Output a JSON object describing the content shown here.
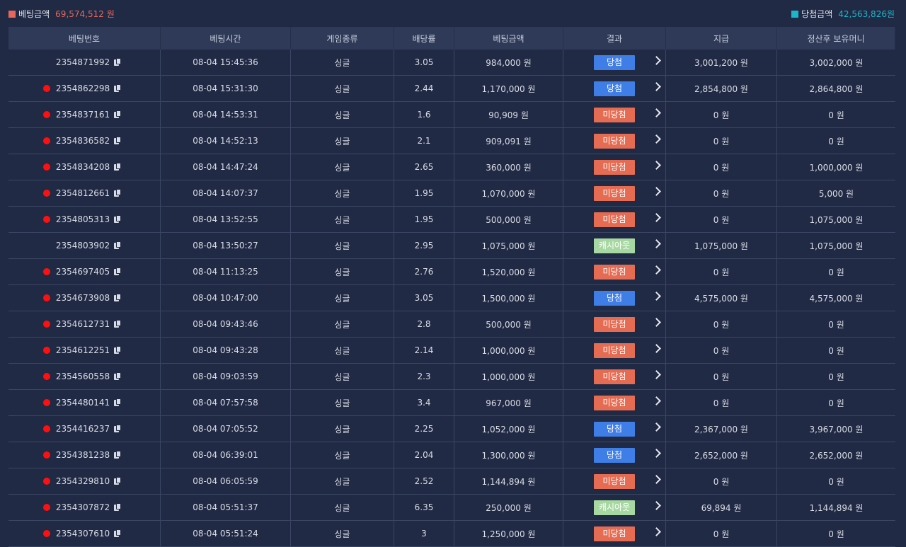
{
  "summary": {
    "bet_label": "베팅금액",
    "bet_value": "69,574,512 원",
    "win_label": "당첨금액",
    "win_value": "42,563,826원",
    "bet_color": "#e8675a",
    "win_color": "#1ab6cc"
  },
  "table": {
    "headers": [
      "베팅번호",
      "베팅시간",
      "게임종류",
      "배당률",
      "베팅금액",
      "결과",
      "지급",
      "정산후 보유머니"
    ],
    "rows": [
      {
        "dot": false,
        "id": "2354871992",
        "time": "08-04 15:45:36",
        "type": "싱글",
        "odds": "3.05",
        "amount": "984,000 원",
        "result": "당첨",
        "status": "win",
        "payout": "3,001,200 원",
        "balance": "3,002,000 원"
      },
      {
        "dot": true,
        "id": "2354862298",
        "time": "08-04 15:31:30",
        "type": "싱글",
        "odds": "2.44",
        "amount": "1,170,000 원",
        "result": "당첨",
        "status": "win",
        "payout": "2,854,800 원",
        "balance": "2,864,800 원"
      },
      {
        "dot": true,
        "id": "2354837161",
        "time": "08-04 14:53:31",
        "type": "싱글",
        "odds": "1.6",
        "amount": "90,909 원",
        "result": "미당첨",
        "status": "lose",
        "payout": "0 원",
        "balance": "0 원"
      },
      {
        "dot": true,
        "id": "2354836582",
        "time": "08-04 14:52:13",
        "type": "싱글",
        "odds": "2.1",
        "amount": "909,091 원",
        "result": "미당첨",
        "status": "lose",
        "payout": "0 원",
        "balance": "0 원"
      },
      {
        "dot": true,
        "id": "2354834208",
        "time": "08-04 14:47:24",
        "type": "싱글",
        "odds": "2.65",
        "amount": "360,000 원",
        "result": "미당첨",
        "status": "lose",
        "payout": "0 원",
        "balance": "1,000,000 원"
      },
      {
        "dot": true,
        "id": "2354812661",
        "time": "08-04 14:07:37",
        "type": "싱글",
        "odds": "1.95",
        "amount": "1,070,000 원",
        "result": "미당첨",
        "status": "lose",
        "payout": "0 원",
        "balance": "5,000 원"
      },
      {
        "dot": true,
        "id": "2354805313",
        "time": "08-04 13:52:55",
        "type": "싱글",
        "odds": "1.95",
        "amount": "500,000 원",
        "result": "미당첨",
        "status": "lose",
        "payout": "0 원",
        "balance": "1,075,000 원"
      },
      {
        "dot": false,
        "id": "2354803902",
        "time": "08-04 13:50:27",
        "type": "싱글",
        "odds": "2.95",
        "amount": "1,075,000 원",
        "result": "캐시아웃",
        "status": "cash",
        "payout": "1,075,000 원",
        "balance": "1,075,000 원"
      },
      {
        "dot": true,
        "id": "2354697405",
        "time": "08-04 11:13:25",
        "type": "싱글",
        "odds": "2.76",
        "amount": "1,520,000 원",
        "result": "미당첨",
        "status": "lose",
        "payout": "0 원",
        "balance": "0 원"
      },
      {
        "dot": true,
        "id": "2354673908",
        "time": "08-04 10:47:00",
        "type": "싱글",
        "odds": "3.05",
        "amount": "1,500,000 원",
        "result": "당첨",
        "status": "win",
        "payout": "4,575,000 원",
        "balance": "4,575,000 원"
      },
      {
        "dot": true,
        "id": "2354612731",
        "time": "08-04 09:43:46",
        "type": "싱글",
        "odds": "2.8",
        "amount": "500,000 원",
        "result": "미당첨",
        "status": "lose",
        "payout": "0 원",
        "balance": "0 원"
      },
      {
        "dot": true,
        "id": "2354612251",
        "time": "08-04 09:43:28",
        "type": "싱글",
        "odds": "2.14",
        "amount": "1,000,000 원",
        "result": "미당첨",
        "status": "lose",
        "payout": "0 원",
        "balance": "0 원"
      },
      {
        "dot": true,
        "id": "2354560558",
        "time": "08-04 09:03:59",
        "type": "싱글",
        "odds": "2.3",
        "amount": "1,000,000 원",
        "result": "미당첨",
        "status": "lose",
        "payout": "0 원",
        "balance": "0 원"
      },
      {
        "dot": true,
        "id": "2354480141",
        "time": "08-04 07:57:58",
        "type": "싱글",
        "odds": "3.4",
        "amount": "967,000 원",
        "result": "미당첨",
        "status": "lose",
        "payout": "0 원",
        "balance": "0 원"
      },
      {
        "dot": true,
        "id": "2354416237",
        "time": "08-04 07:05:52",
        "type": "싱글",
        "odds": "2.25",
        "amount": "1,052,000 원",
        "result": "당첨",
        "status": "win",
        "payout": "2,367,000 원",
        "balance": "3,967,000 원"
      },
      {
        "dot": true,
        "id": "2354381238",
        "time": "08-04 06:39:01",
        "type": "싱글",
        "odds": "2.04",
        "amount": "1,300,000 원",
        "result": "당첨",
        "status": "win",
        "payout": "2,652,000 원",
        "balance": "2,652,000 원"
      },
      {
        "dot": true,
        "id": "2354329810",
        "time": "08-04 06:05:59",
        "type": "싱글",
        "odds": "2.52",
        "amount": "1,144,894 원",
        "result": "미당첨",
        "status": "lose",
        "payout": "0 원",
        "balance": "0 원"
      },
      {
        "dot": true,
        "id": "2354307872",
        "time": "08-04 05:51:37",
        "type": "싱글",
        "odds": "6.35",
        "amount": "250,000 원",
        "result": "캐시아웃",
        "status": "cash",
        "payout": "69,894 원",
        "balance": "1,144,894 원"
      },
      {
        "dot": true,
        "id": "2354307610",
        "time": "08-04 05:51:24",
        "type": "싱글",
        "odds": "3",
        "amount": "1,250,000 원",
        "result": "미당첨",
        "status": "lose",
        "payout": "0 원",
        "balance": "0 원"
      }
    ]
  },
  "icons": {
    "copy": "copy-icon",
    "detail": "chevron-right-icon",
    "unread": "red-dot-indicator"
  }
}
